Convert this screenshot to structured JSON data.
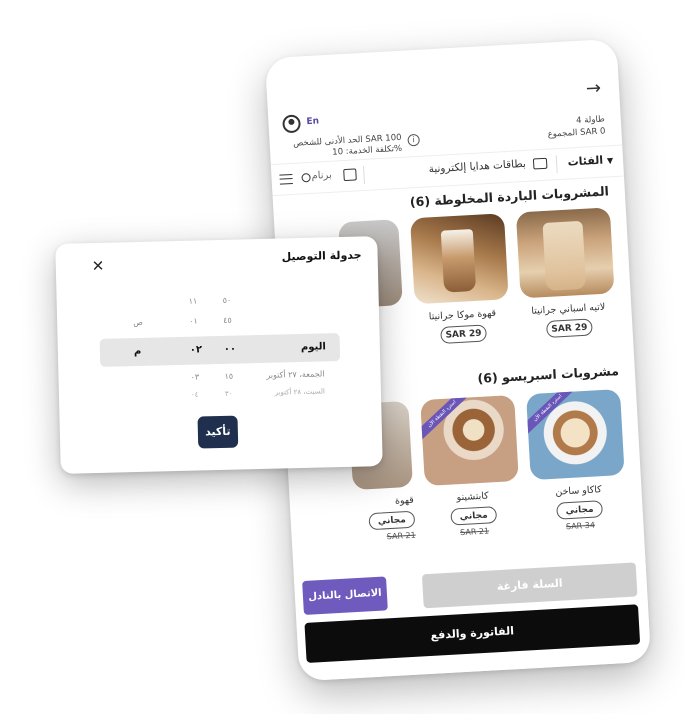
{
  "header": {
    "language": "En",
    "table": "طاولة 4",
    "total": "المجموع SAR 0",
    "min_charge": "الحد الأدنى للشخص SAR 100",
    "service_fee": "تكلفة الخدمة: 10%"
  },
  "categories": {
    "main": "الفئات",
    "gift_cards": "بطاقات هدايا إلكترونية",
    "programs": "برنام"
  },
  "sections": [
    {
      "title": "المشروبات الباردة المخلوطة (6)",
      "items": [
        {
          "name": "لاتيه اسباني جرانيتا",
          "price": "SAR 29"
        },
        {
          "name": "قهوة موكا جرانيتا",
          "price": "SAR 29"
        }
      ]
    },
    {
      "title": "مشروبات اسبريسو (6)",
      "items": [
        {
          "name": "كاكاو ساخن",
          "price": "مجاني",
          "old_price": "SAR 34",
          "ribbon": "استرد النقطة الآن"
        },
        {
          "name": "كابتشينو",
          "price": "مجاني",
          "old_price": "SAR 21",
          "ribbon": "استرد النقطة الآن"
        },
        {
          "name": "قهوة",
          "price": "مجاني",
          "old_price": "SAR 21"
        }
      ]
    }
  ],
  "actions": {
    "empty_cart": "السلة فارغة",
    "call_waiter": "الاتصال بالنادل",
    "invoice_pay": "الفاتورة والدفع"
  },
  "dialog": {
    "title": "جدولة التوصيل",
    "confirm": "تأكيد",
    "rows_above": [
      {
        "day": "",
        "hour": "١١",
        "minute": "٥٠",
        "period": ""
      },
      {
        "day": "",
        "hour": "٠١",
        "minute": "٤٥",
        "period": "ص"
      }
    ],
    "selected": {
      "day": "اليوم",
      "hour": "٠٢",
      "minute": "٠٠",
      "period": "م"
    },
    "rows_below": [
      {
        "day": "الجمعة، ٢٧ أكتوبر",
        "hour": "٠٣",
        "minute": "١٥",
        "period": ""
      },
      {
        "day": "السبت، ٢٨ أكتوبر",
        "hour": "٠٤",
        "minute": "٣٠",
        "period": ""
      }
    ]
  },
  "colors": {
    "accent": "#6e5bbd",
    "confirm": "#1f2f4d",
    "pay_button": "#0c0c0c",
    "disabled": "#cfcfcf"
  }
}
